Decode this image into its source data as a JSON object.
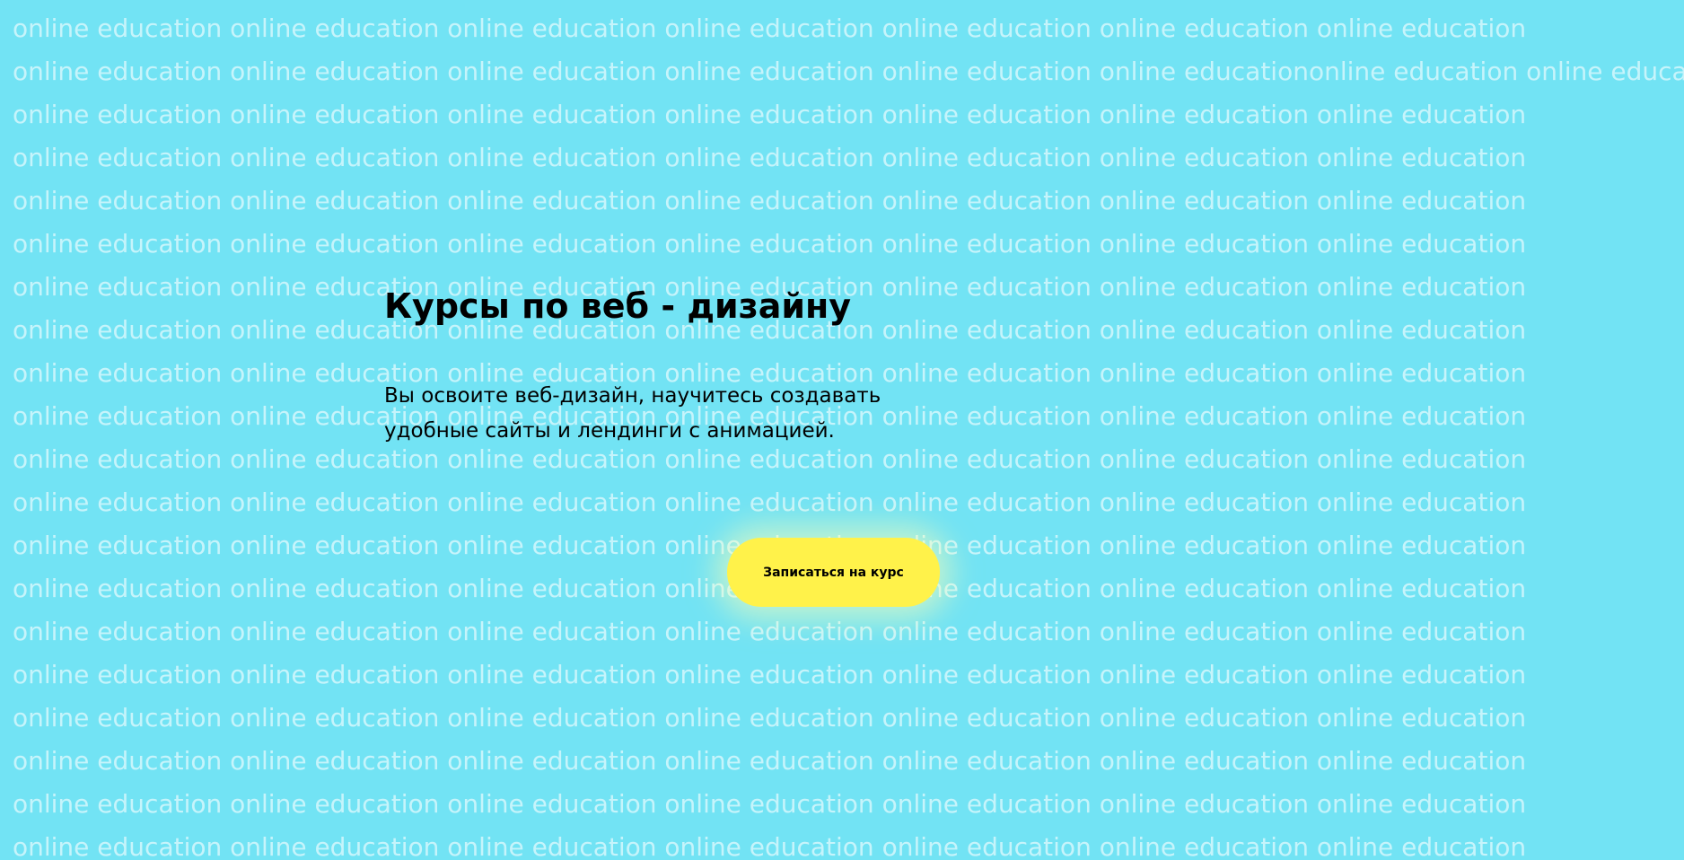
{
  "background": {
    "pattern_text": "online education online education online education online education online education online education online education",
    "line2_text": "online education online education online education online education online education online educationonline education online education",
    "line_count": 20
  },
  "hero": {
    "title": "Курсы по веб - дизайну",
    "description": "Вы освоите веб-дизайн, научитесь создавать удобные сайты и лендинги с анимацией."
  },
  "cta": {
    "label": "Записаться на курс"
  },
  "colors": {
    "background": "#72e3f4",
    "button": "#fff24a",
    "text": "#000000"
  }
}
